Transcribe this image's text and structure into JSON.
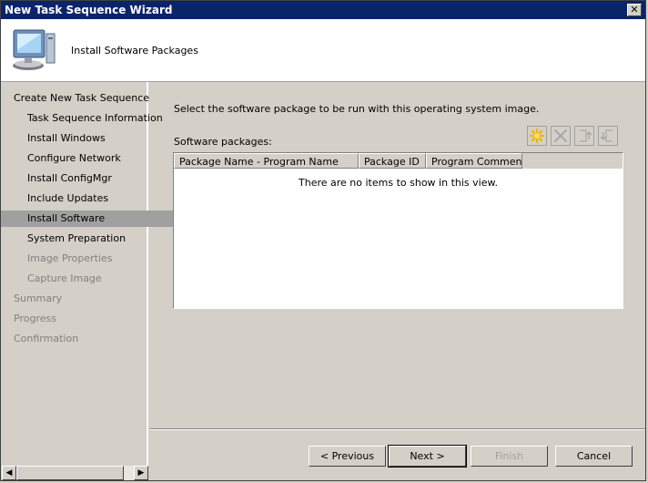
{
  "window": {
    "title": "New Task Sequence Wizard",
    "close_glyph": "✕"
  },
  "header": {
    "title": "Install Software Packages",
    "icon": "computer-icon"
  },
  "sidebar": {
    "items": [
      {
        "label": "Create New Task Sequence",
        "level": 0,
        "state": "normal"
      },
      {
        "label": "Task Sequence Information",
        "level": 1,
        "state": "normal"
      },
      {
        "label": "Install Windows",
        "level": 1,
        "state": "normal"
      },
      {
        "label": "Configure Network",
        "level": 1,
        "state": "normal"
      },
      {
        "label": "Install ConfigMgr",
        "level": 1,
        "state": "normal"
      },
      {
        "label": "Include Updates",
        "level": 1,
        "state": "normal"
      },
      {
        "label": "Install Software",
        "level": 1,
        "state": "selected"
      },
      {
        "label": "System Preparation",
        "level": 1,
        "state": "normal"
      },
      {
        "label": "Image Properties",
        "level": 1,
        "state": "disabled"
      },
      {
        "label": "Capture Image",
        "level": 1,
        "state": "disabled"
      },
      {
        "label": "Summary",
        "level": 0,
        "state": "disabled"
      },
      {
        "label": "Progress",
        "level": 0,
        "state": "disabled"
      },
      {
        "label": "Confirmation",
        "level": 0,
        "state": "disabled"
      }
    ]
  },
  "main": {
    "instruction": "Select the software package to be run with this operating system image.",
    "packages_label": "Software packages:",
    "toolbar": [
      {
        "icon": "new-star-icon",
        "enabled": true
      },
      {
        "icon": "delete-x-icon",
        "enabled": false
      },
      {
        "icon": "move-up-icon",
        "enabled": false
      },
      {
        "icon": "move-down-icon",
        "enabled": false
      }
    ],
    "columns": [
      "Package Name - Program Name",
      "Package ID",
      "Program Comments"
    ],
    "empty_text": "There are no items to show in this view."
  },
  "buttons": {
    "previous": "< Previous",
    "next": "Next >",
    "finish": "Finish",
    "cancel": "Cancel"
  },
  "colors": {
    "titlebar": "#0a246a",
    "selected_nav": "#a0a0a0",
    "disabled_text": "#808080"
  }
}
